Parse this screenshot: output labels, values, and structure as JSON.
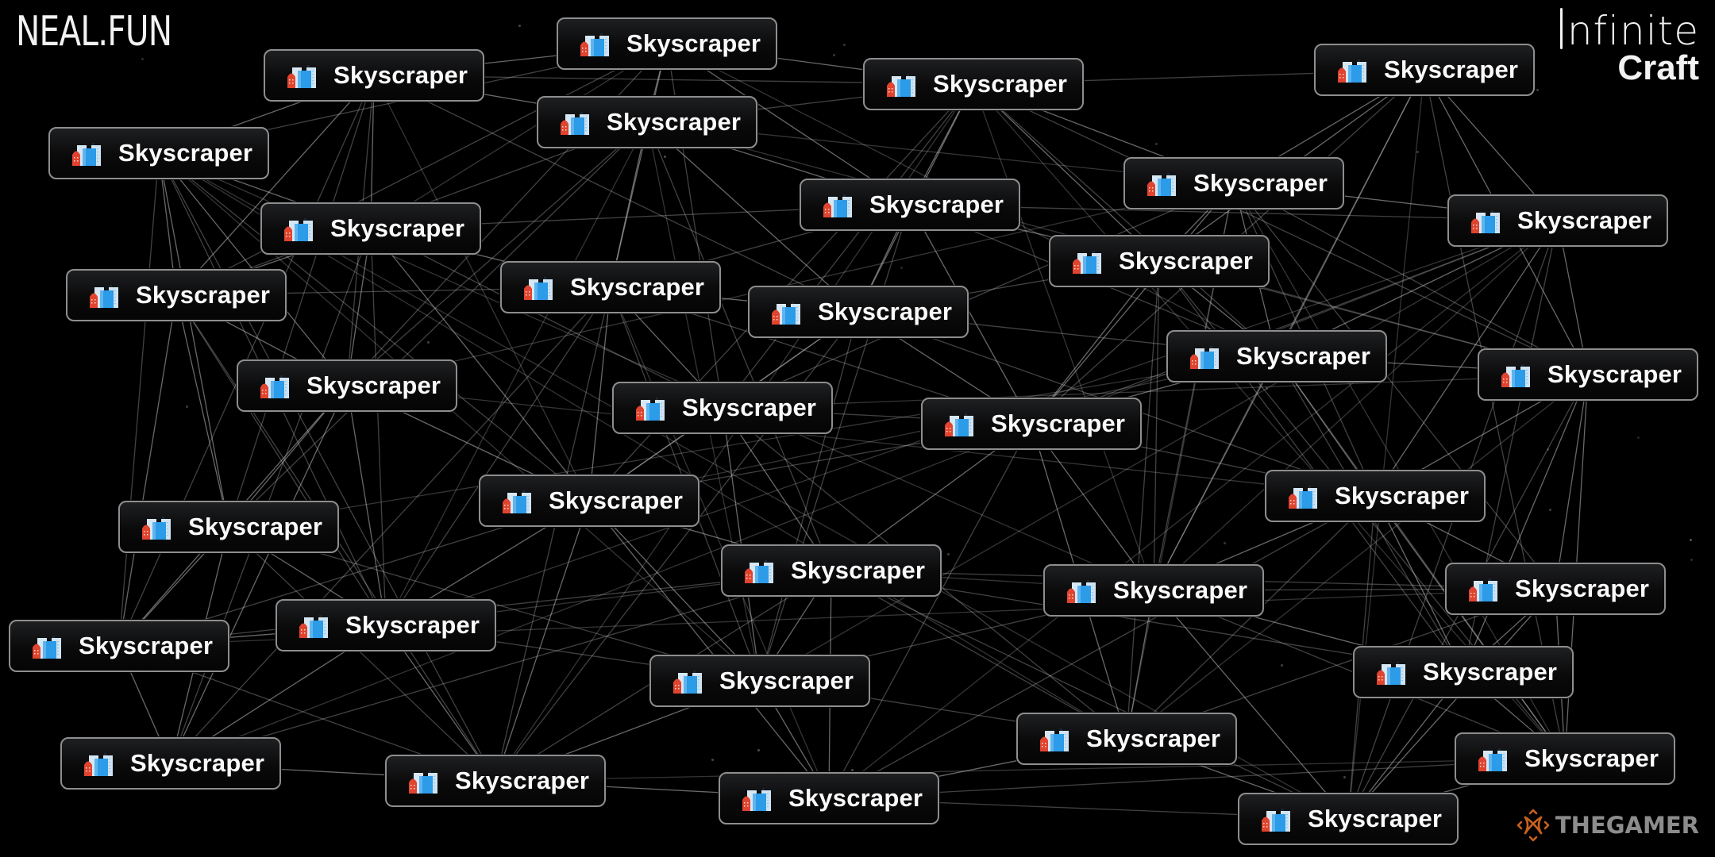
{
  "branding": {
    "left_logo": "NEAL.FUN",
    "right_title_line1": "nfinite",
    "right_title_line2": "Craft",
    "watermark": "THEGAMER"
  },
  "colors": {
    "background": "#000000",
    "node_border": "#8e8e8e",
    "node_text": "#fafafa",
    "edge": "#bdbdbd",
    "icon_red": "#e0442f",
    "icon_blue": "#2c9be8",
    "icon_light": "#cfe3f2",
    "watermark_orange": "#c8611f",
    "watermark_text": "#8c8c8c"
  },
  "element_icon": "skyscraper-icon",
  "nodes": [
    {
      "label": "Skyscraper"
    },
    {
      "label": "Skyscraper"
    },
    {
      "label": "Skyscraper"
    },
    {
      "label": "Skyscraper"
    },
    {
      "label": "Skyscraper"
    },
    {
      "label": "Skyscraper"
    },
    {
      "label": "Skyscraper"
    },
    {
      "label": "Skyscraper"
    },
    {
      "label": "Skyscraper"
    },
    {
      "label": "Skyscraper"
    },
    {
      "label": "Skyscraper"
    },
    {
      "label": "Skyscraper"
    },
    {
      "label": "Skyscraper"
    },
    {
      "label": "Skyscraper"
    },
    {
      "label": "Skyscraper"
    },
    {
      "label": "Skyscraper"
    },
    {
      "label": "Skyscraper"
    },
    {
      "label": "Skyscraper"
    },
    {
      "label": "Skyscraper"
    },
    {
      "label": "Skyscraper"
    },
    {
      "label": "Skyscraper"
    },
    {
      "label": "Skyscraper"
    },
    {
      "label": "Skyscraper"
    },
    {
      "label": "Skyscraper"
    },
    {
      "label": "Skyscraper"
    },
    {
      "label": "Skyscraper"
    },
    {
      "label": "Skyscraper"
    },
    {
      "label": "Skyscraper"
    },
    {
      "label": "Skyscraper"
    },
    {
      "label": "Skyscraper"
    },
    {
      "label": "Skyscraper"
    },
    {
      "label": "Skyscraper"
    },
    {
      "label": "Skyscraper"
    },
    {
      "label": "Skyscraper"
    },
    {
      "label": "Skyscraper"
    }
  ]
}
